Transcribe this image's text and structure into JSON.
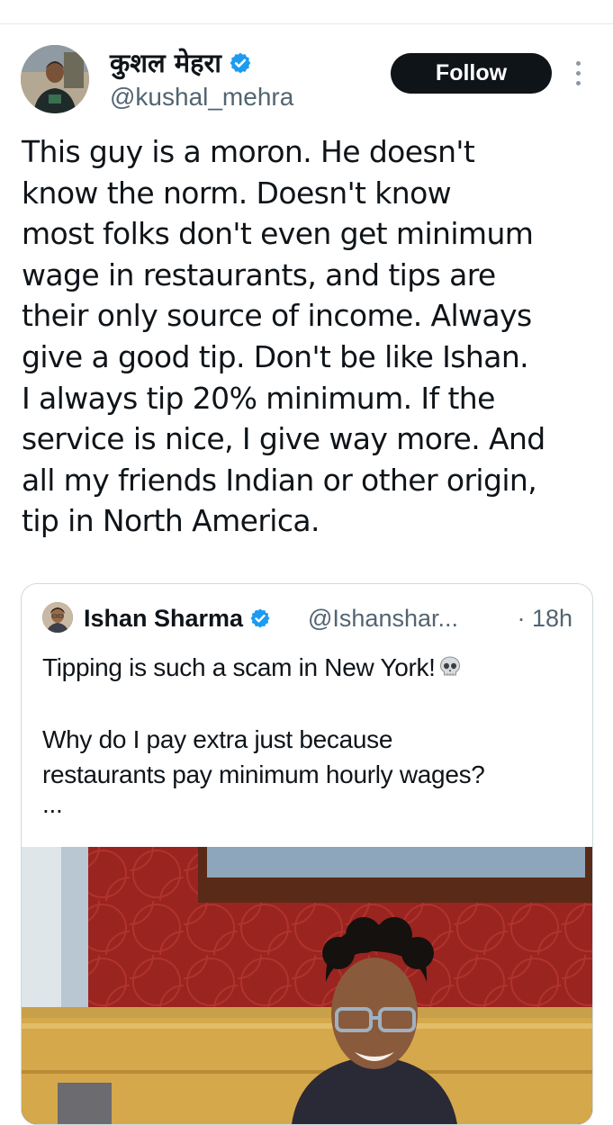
{
  "author": {
    "name": "कुशल मेहरा",
    "handle": "@kushal_mehra",
    "verified": true
  },
  "actions": {
    "follow_label": "Follow"
  },
  "tweet": {
    "lines": [
      "This guy is a moron. He doesn't",
      "know the norm. Doesn't know",
      "most folks don't even get minimum",
      "wage in restaurants, and tips are",
      "their only source of income. Always",
      "give a good tip. Don't be like Ishan.",
      "I always tip 20% minimum. If the",
      "service is nice, I give way more. And",
      "all my friends Indian or other origin,",
      "tip in North America."
    ]
  },
  "quoted": {
    "name": "Ishan Sharma",
    "handle": "@Ishanshar...",
    "time": "· 18h",
    "line1": "Tipping is such a scam in New York!",
    "line2": "Why do I pay extra just because",
    "line3": "restaurants pay minimum hourly wages?",
    "line4": "...",
    "emoji_icon": "skull-icon",
    "photo": "photo-of-young-man-with-glasses-in-restaurant-booth"
  },
  "colors": {
    "text": "#0f1419",
    "secondary": "#536471",
    "verified": "#1d9bf0",
    "follow_bg": "#0f1419",
    "border": "#cfd9de"
  }
}
